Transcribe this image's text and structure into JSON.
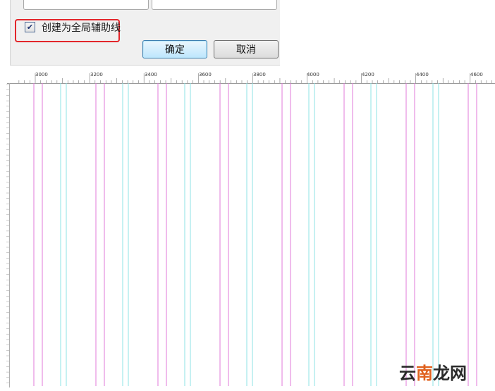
{
  "dialog": {
    "checkbox_label": "创建为全局辅助线",
    "checkbox_checked": true,
    "checkbox_mark": "✔",
    "ok_label": "确定",
    "cancel_label": "取消",
    "highlight_color": "#e3262b"
  },
  "ruler": {
    "labels": [
      "3000",
      "3200",
      "3400",
      "3600",
      "3800",
      "4000",
      "4200",
      "4400",
      "4600"
    ]
  },
  "guides": {
    "magenta_color": "#e27ad8",
    "cyan_color": "#8ee3e6"
  },
  "watermark": {
    "part1": "云",
    "part2": "南",
    "part3": "龙网"
  }
}
